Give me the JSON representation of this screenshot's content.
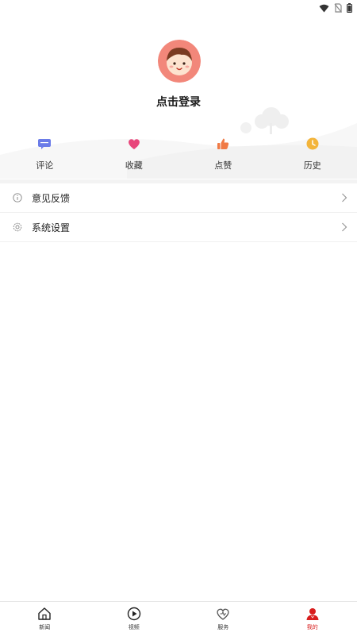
{
  "colors": {
    "accent": "#d81e1e",
    "comment_icon": "#6b7ce8",
    "favorite_icon": "#e8457a",
    "like_icon": "#f07a45",
    "history_icon": "#f3b43a",
    "avatar_bg": "#f2877a"
  },
  "status_bar": {
    "icons": [
      "wifi-icon",
      "no-sim-icon",
      "battery-icon"
    ]
  },
  "profile": {
    "login_text": "点击登录",
    "avatar": "avatar-girl-icon"
  },
  "quick_actions": [
    {
      "label": "评论",
      "icon": "comment-icon"
    },
    {
      "label": "收藏",
      "icon": "heart-icon"
    },
    {
      "label": "点赞",
      "icon": "thumbs-up-icon"
    },
    {
      "label": "历史",
      "icon": "clock-icon"
    }
  ],
  "menu": [
    {
      "label": "意见反馈",
      "icon": "info-icon"
    },
    {
      "label": "系统设置",
      "icon": "settings-icon"
    }
  ],
  "tabbar": [
    {
      "label": "新闻",
      "icon": "home-icon",
      "active": false
    },
    {
      "label": "视频",
      "icon": "play-icon",
      "active": false
    },
    {
      "label": "服务",
      "icon": "heart-outline-icon",
      "active": false
    },
    {
      "label": "我的",
      "icon": "person-icon",
      "active": true
    }
  ]
}
